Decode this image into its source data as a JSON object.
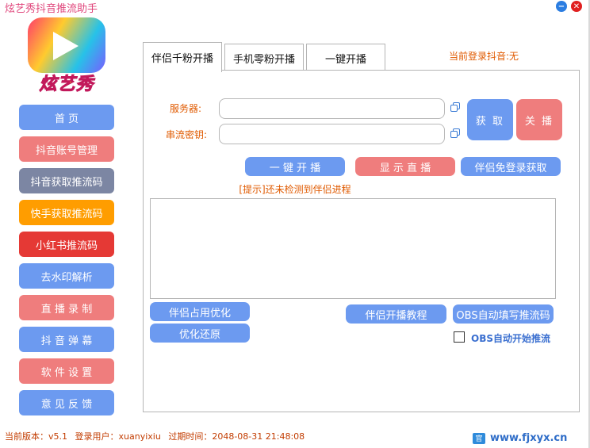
{
  "window": {
    "title": "炫艺秀抖音推流助手",
    "minimize_glyph": "−",
    "close_glyph": "✕"
  },
  "logo": {
    "text": "炫艺秀"
  },
  "sidebar": {
    "items": [
      {
        "label": "首 页",
        "color": "#6c9af0"
      },
      {
        "label": "抖音账号管理",
        "color": "#ef7d7d"
      },
      {
        "label": "抖音获取推流码",
        "color": "#7c86a3"
      },
      {
        "label": "快手获取推流码",
        "color": "#ff9d00"
      },
      {
        "label": "小红书推流码",
        "color": "#e53935"
      },
      {
        "label": "去水印解析",
        "color": "#6c9af0"
      },
      {
        "label": "直 播 录 制",
        "color": "#ef7d7d"
      },
      {
        "label": "抖 音 弹 幕",
        "color": "#6c9af0"
      },
      {
        "label": "软 件 设 置",
        "color": "#ef7d7d"
      },
      {
        "label": "意 见 反 馈",
        "color": "#6c9af0"
      }
    ]
  },
  "tabs": [
    {
      "label": "伴侣千粉开播",
      "active": true
    },
    {
      "label": "手机零粉开播",
      "active": false
    },
    {
      "label": "一键开播",
      "active": false
    }
  ],
  "login_status": "当前登录抖音:无",
  "form": {
    "server_label": "服务器:",
    "server_value": "",
    "key_label": "串流密钥:",
    "key_value": ""
  },
  "buttons": {
    "fetch": "获 取",
    "stop": "关 播",
    "one_click_start": "一 键 开 播",
    "show_live": "显 示 直 播",
    "companion_free_login": "伴侣免登录获取",
    "companion_optimize": "伴侣占用优化",
    "restore_optimize": "优化还原",
    "companion_tutorial": "伴侣开播教程",
    "obs_auto_fill": "OBS自动填写推流码"
  },
  "hint": "[提示]还未检测到伴侣进程",
  "obs_auto_start": {
    "label": "OBS自动开始推流",
    "checked": false
  },
  "footer": {
    "version": "当前版本：v5.1",
    "user": "登录用户：xuanyixiu",
    "expire": "过期时间：2048-08-31 21:48:08"
  },
  "site": {
    "icon_text": "官",
    "text": "www.fjxyx.cn"
  }
}
